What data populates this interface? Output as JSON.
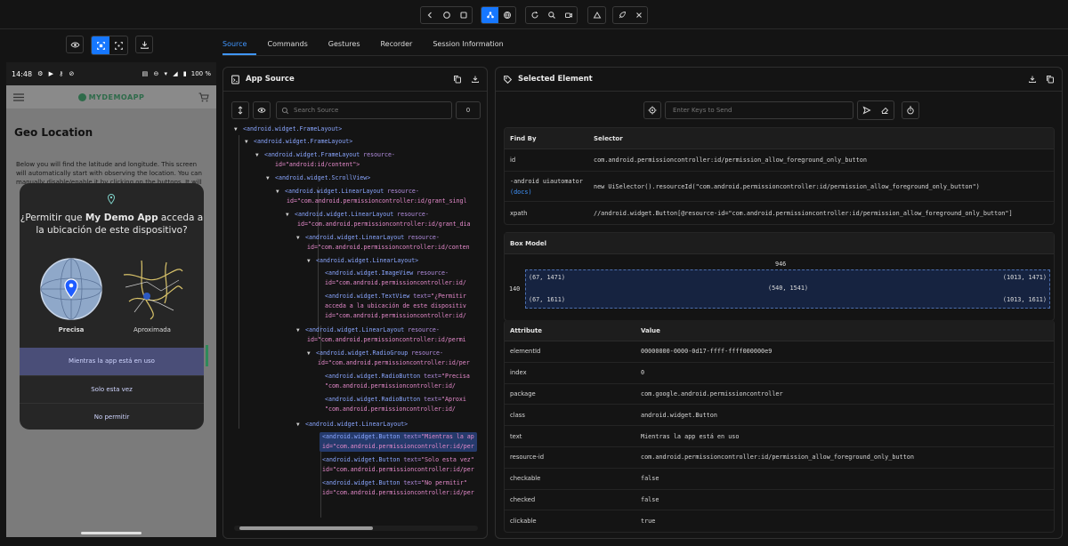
{
  "tabs": [
    "Source",
    "Commands",
    "Gestures",
    "Recorder",
    "Session Information"
  ],
  "phone": {
    "status_time": "14:48",
    "battery": "100 %",
    "app_logo": "MYDEMOAPP",
    "geo_title": "Geo Location",
    "geo_desc_1": "Below you will find the latitude and longitude. This screen",
    "geo_desc_2": "will automatically start with observing the location. You can",
    "geo_desc_3": "manually disable/enable it by clicking on the buttons. It will",
    "dialog": {
      "title_pre": "¿Permitir que ",
      "title_app": "My Demo App",
      "title_post": " acceda a la ubicación de este dispositivo?",
      "option_precise": "Precisa",
      "option_approx": "Aproximada",
      "btn_while_using": "Mientras la app está en uso",
      "btn_only_once": "Solo esta vez",
      "btn_deny": "No permitir"
    }
  },
  "source": {
    "title": "App Source",
    "search_placeholder": "Search Source",
    "match_count": "0",
    "nodes": [
      {
        "tag": "android.widget.FrameLayout",
        "attr": "",
        "val": "",
        "line2": ""
      },
      {
        "tag": "android.widget.FrameLayout",
        "attr": "",
        "val": "",
        "line2": ""
      },
      {
        "tag": "android.widget.FrameLayout",
        "attr": " resource-",
        "val": "",
        "line2": "id=\"android:id/content\">"
      },
      {
        "tag": "android.widget.ScrollView",
        "attr": "",
        "val": "",
        "line2": ""
      },
      {
        "tag": "android.widget.LinearLayout",
        "attr": " resource-",
        "val": "",
        "line2": "id=\"com.android.permissioncontroller:id/grant_singl"
      },
      {
        "tag": "android.widget.LinearLayout",
        "attr": " resource-",
        "val": "",
        "line2": "id=\"com.android.permissioncontroller:id/grant_dia"
      },
      {
        "tag": "android.widget.LinearLayout",
        "attr": " resource-",
        "val": "",
        "line2": "id=\"com.android.permissioncontroller:id/conten"
      },
      {
        "tag": "android.widget.LinearLayout",
        "attr": "",
        "val": "",
        "line2": ""
      },
      {
        "tag": "android.widget.ImageView",
        "attr": " resource-",
        "val": "",
        "line2": "id=\"com.android.permissioncontroller:id/"
      },
      {
        "tag": "android.widget.TextView",
        "attr": " text=",
        "val": "\"¿Permitir",
        "line2": "acceda a la ubicación de este dispositiv",
        "line3": "id=\"com.android.permissioncontroller:id/"
      },
      {
        "tag": "android.widget.LinearLayout",
        "attr": " resource-",
        "val": "",
        "line2": "id=\"com.android.permissioncontroller:id/permi"
      },
      {
        "tag": "android.widget.RadioGroup",
        "attr": " resource-",
        "val": "",
        "line2": "id=\"com.android.permissioncontroller:id/per"
      },
      {
        "tag": "android.widget.RadioButton",
        "attr": " text=",
        "val": "\"Precisa",
        "line2": "\"com.android.permissioncontroller:id/"
      },
      {
        "tag": "android.widget.RadioButton",
        "attr": " text=",
        "val": "\"Aproxi",
        "line2": "\"com.android.permissioncontroller:id/"
      },
      {
        "tag": "android.widget.LinearLayout",
        "attr": "",
        "val": "",
        "line2": ""
      },
      {
        "tag": "android.widget.Button",
        "attr": " text=",
        "val": "\"Mientras la ap",
        "line2": "id=\"com.android.permissioncontroller:id/per"
      },
      {
        "tag": "android.widget.Button",
        "attr": " text=",
        "val": "\"Solo esta vez\"",
        "line2": "id=\"com.android.permissioncontroller:id/per"
      },
      {
        "tag": "android.widget.Button",
        "attr": " text=",
        "val": "\"No permitir\"",
        "line2": "id=\"com.android.permissioncontroller:id/per"
      }
    ]
  },
  "selected": {
    "title": "Selected Element",
    "keys_placeholder": "Enter Keys to Send",
    "find_by_header": "Find By",
    "selector_header": "Selector",
    "rows": [
      {
        "by": "id",
        "sel": "com.android.permissioncontroller:id/permission_allow_foreground_only_button"
      },
      {
        "by": "-android uiautomator",
        "sub": "(docs)",
        "sel": "new UiSelector().resourceId(\"com.android.permissioncontroller:id/permission_allow_foreground_only_button\")"
      },
      {
        "by": "xpath",
        "sel": "//android.widget.Button[@resource-id=\"com.android.permissioncontroller:id/permission_allow_foreground_only_button\"]"
      }
    ],
    "box_model": {
      "title": "Box Model",
      "width": "946",
      "height": "140",
      "top_left": "(67, 1471)",
      "top_right": "(1013, 1471)",
      "center": "(540, 1541)",
      "bottom_left": "(67, 1611)",
      "bottom_right": "(1013, 1611)"
    },
    "attr_header": "Attribute",
    "value_header": "Value",
    "attributes": [
      {
        "k": "elementId",
        "v": "00000000-0000-0d17-ffff-ffff000000e9"
      },
      {
        "k": "index",
        "v": "0"
      },
      {
        "k": "package",
        "v": "com.google.android.permissioncontroller"
      },
      {
        "k": "class",
        "v": "android.widget.Button"
      },
      {
        "k": "text",
        "v": "Mientras la app está en uso"
      },
      {
        "k": "resource-id",
        "v": "com.android.permissioncontroller:id/permission_allow_foreground_only_button"
      },
      {
        "k": "checkable",
        "v": "false"
      },
      {
        "k": "checked",
        "v": "false"
      },
      {
        "k": "clickable",
        "v": "true"
      }
    ]
  },
  "colors": {
    "accent": "#1677ff",
    "tag": "#8aa6ff",
    "attr": "#b48ee0",
    "val": "#e58acb"
  }
}
